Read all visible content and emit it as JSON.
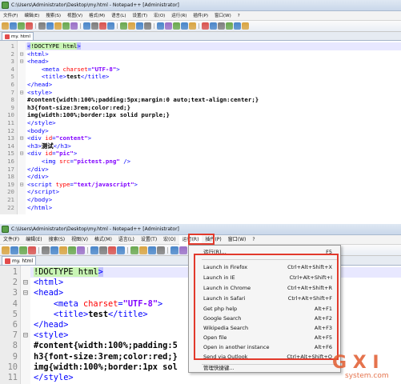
{
  "top": {
    "title": "C:\\Users\\Administrator\\Desktop\\my.html - Notepad++ [Administrator]",
    "menu": [
      "文件(F)",
      "编辑(E)",
      "搜索(S)",
      "视图(V)",
      "格式(M)",
      "语言(L)",
      "设置(T)",
      "宏(O)",
      "运行(R)",
      "插件(P)",
      "窗口(W)",
      "?"
    ],
    "tab_label": "my. html",
    "lines": [
      {
        "n": "1",
        "fold": "",
        "html": "<span class='t-tag sel-tag'>&lt;</span><span class='t-doc'>!DOCTYPE html</span><span class='t-tag sel-tag'>&gt;</span>"
      },
      {
        "n": "2",
        "fold": "⊟",
        "html": "<span class='t-tag'>&lt;html&gt;</span>"
      },
      {
        "n": "3",
        "fold": "⊟",
        "html": "<span class='t-tag'>&lt;head&gt;</span>"
      },
      {
        "n": "4",
        "fold": "",
        "html": "    <span class='t-tag'>&lt;meta</span> <span class='t-attr'>charset</span><span class='t-tag'>=</span><span class='t-val'>\"UTF-8\"</span><span class='t-tag'>&gt;</span>"
      },
      {
        "n": "5",
        "fold": "",
        "html": "    <span class='t-tag'>&lt;title&gt;</span><span class='t-txt'>test</span><span class='t-tag'>&lt;/title&gt;</span>"
      },
      {
        "n": "6",
        "fold": "",
        "html": "<span class='t-tag'>&lt;/head&gt;</span>"
      },
      {
        "n": "7",
        "fold": "⊟",
        "html": "<span class='t-tag'>&lt;style&gt;</span>"
      },
      {
        "n": "8",
        "fold": "",
        "html": "<span class='t-css'>#content{width:100%;padding:5px;margin:0 auto;text-align:center;}</span>"
      },
      {
        "n": "9",
        "fold": "",
        "html": "<span class='t-css'>h3{font-size:3rem;color:red;}</span>"
      },
      {
        "n": "10",
        "fold": "",
        "html": "<span class='t-css'>img{width:100%;border:1px solid purple;}</span>"
      },
      {
        "n": "11",
        "fold": "",
        "html": "<span class='t-tag'>&lt;/style&gt;</span>"
      },
      {
        "n": "12",
        "fold": "",
        "html": "<span class='t-tag'>&lt;body&gt;</span>"
      },
      {
        "n": "13",
        "fold": "⊟",
        "html": "<span class='t-tag'>&lt;div</span> <span class='t-attr'>id</span><span class='t-tag'>=</span><span class='t-val'>\"content\"</span><span class='t-tag'>&gt;</span>"
      },
      {
        "n": "14",
        "fold": "",
        "html": "<span class='t-tag'>&lt;h3&gt;</span><span class='t-txt'>测试</span><span class='t-tag'>&lt;/h3&gt;</span>"
      },
      {
        "n": "15",
        "fold": "⊟",
        "html": "<span class='t-tag'>&lt;div</span> <span class='t-attr'>id</span><span class='t-tag'>=</span><span class='t-val'>\"pic\"</span><span class='t-tag'>&gt;</span>"
      },
      {
        "n": "16",
        "fold": "",
        "html": "    <span class='t-tag'>&lt;img</span> <span class='t-attr'>src</span><span class='t-tag'>=</span><span class='t-val'>\"pictest.png\"</span> <span class='t-tag'>/&gt;</span>"
      },
      {
        "n": "17",
        "fold": "",
        "html": "<span class='t-tag'>&lt;/div&gt;</span>"
      },
      {
        "n": "18",
        "fold": "",
        "html": "<span class='t-tag'>&lt;/div&gt;</span>"
      },
      {
        "n": "19",
        "fold": "⊟",
        "html": "<span class='t-tag'>&lt;script</span> <span class='t-attr'>type</span><span class='t-tag'>=</span><span class='t-val'>\"text/javascript\"</span><span class='t-tag'>&gt;</span>"
      },
      {
        "n": "20",
        "fold": "",
        "html": "<span class='t-tag'>&lt;/script&gt;</span>"
      },
      {
        "n": "21",
        "fold": "",
        "html": "<span class='t-tag'>&lt;/body&gt;</span>"
      },
      {
        "n": "22",
        "fold": "",
        "html": "<span class='t-tag'>&lt;/html&gt;</span>"
      }
    ]
  },
  "bottom": {
    "title": "C:\\Users\\Administrator\\Desktop\\my.html - Notepad++ [Administrator]",
    "menu": [
      "文件(F)",
      "编辑(E)",
      "搜索(S)",
      "视图(V)",
      "格式(M)",
      "语言(L)",
      "设置(T)",
      "宏(O)",
      "运行(R)",
      "插件(P)",
      "窗口(W)",
      "?"
    ],
    "tab_label": "my. html",
    "lines": [
      {
        "n": "1",
        "fold": "",
        "html": "<span class='t-doc'>!DOCTYPE html</span><span class='t-tag sel-tag'>&gt;</span>"
      },
      {
        "n": "2",
        "fold": "⊟",
        "html": "<span class='t-tag'>&lt;html&gt;</span>"
      },
      {
        "n": "3",
        "fold": "⊟",
        "html": "<span class='t-tag'>&lt;head&gt;</span>"
      },
      {
        "n": "4",
        "fold": "",
        "html": "    <span class='t-tag'>&lt;meta</span> <span class='t-attr'>charset</span><span class='t-tag'>=</span><span class='t-val'>\"UTF-8\"</span><span class='t-tag'>&gt;</span>"
      },
      {
        "n": "5",
        "fold": "",
        "html": "    <span class='t-tag'>&lt;title&gt;</span><span class='t-txt'>test</span><span class='t-tag'>&lt;/title&gt;</span>"
      },
      {
        "n": "6",
        "fold": "",
        "html": "<span class='t-tag'>&lt;/head&gt;</span>"
      },
      {
        "n": "7",
        "fold": "⊟",
        "html": "<span class='t-tag'>&lt;style&gt;</span>"
      },
      {
        "n": "8",
        "fold": "",
        "html": "<span class='t-css'>#content{width:100%;padding:5</span>"
      },
      {
        "n": "9",
        "fold": "",
        "html": "<span class='t-css'>h3{font-size:3rem;color:red;}</span>"
      },
      {
        "n": "10",
        "fold": "",
        "html": "<span class='t-css'>img{width:100%;border:1px sol</span>"
      },
      {
        "n": "11",
        "fold": "",
        "html": "<span class='t-tag'>&lt;/style&gt;</span>"
      }
    ],
    "run_menu": {
      "items": [
        {
          "label": "运行(R)...",
          "shortcut": "F5"
        },
        {
          "label": "Launch in Firefox",
          "shortcut": "Ctrl+Alt+Shift+X"
        },
        {
          "label": "Launch in IE",
          "shortcut": "Ctrl+Alt+Shift+I"
        },
        {
          "label": "Launch in Chrome",
          "shortcut": "Ctrl+Alt+Shift+R"
        },
        {
          "label": "Launch in Safari",
          "shortcut": "Ctrl+Alt+Shift+F"
        },
        {
          "label": "Get php help",
          "shortcut": "Alt+F1"
        },
        {
          "label": "Google Search",
          "shortcut": "Alt+F2"
        },
        {
          "label": "Wikipedia Search",
          "shortcut": "Alt+F3"
        },
        {
          "label": "Open file",
          "shortcut": "Alt+F5"
        },
        {
          "label": "Open in another instance",
          "shortcut": "Alt+F6"
        },
        {
          "label": "Send via Outlook",
          "shortcut": "Ctrl+Alt+Shift+O"
        },
        {
          "label": "管理快捷键...",
          "shortcut": ""
        }
      ]
    }
  },
  "watermark": {
    "brand": "G X I",
    "site": "system.com"
  },
  "colors": {
    "highlight_box": "#e23a2c"
  }
}
